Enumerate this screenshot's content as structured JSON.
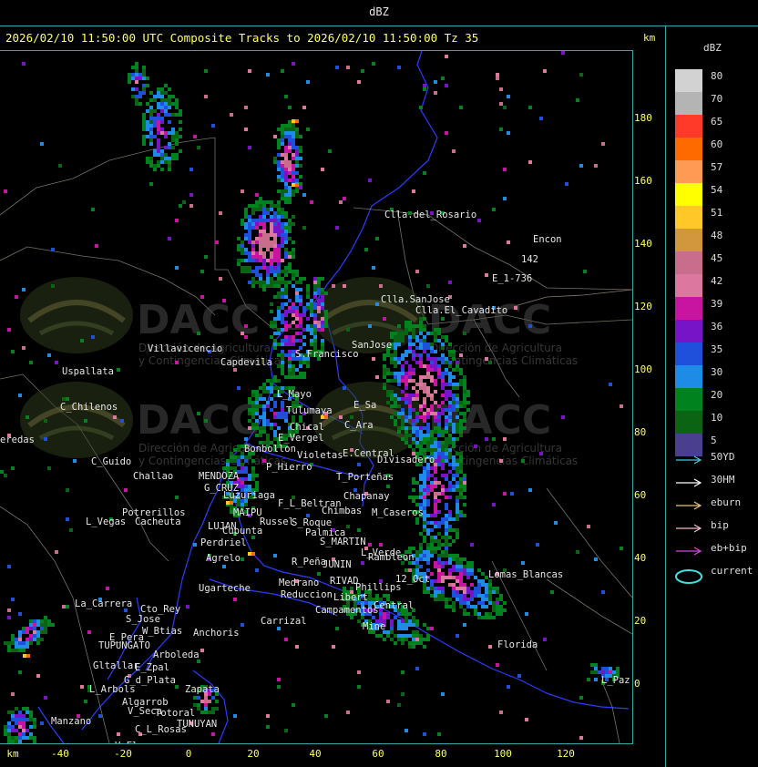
{
  "window": {
    "title": "dBZ"
  },
  "header": {
    "text": "2026/02/10 11:50:00 UTC Composite Tracks to 2026/02/10 11:50:00 Tz 35"
  },
  "axes": {
    "unit_top": "km",
    "unit_bottom": "km",
    "y_ticks": [
      "180",
      "160",
      "140",
      "120",
      "100",
      "80",
      "60",
      "40",
      "20",
      "0"
    ],
    "x_ticks": [
      "-40",
      "-20",
      "0",
      "20",
      "40",
      "60",
      "80",
      "100",
      "120"
    ]
  },
  "legend": {
    "title": "dBZ",
    "levels": [
      {
        "value": "80",
        "color": "#d2d2d2"
      },
      {
        "value": "70",
        "color": "#b4b4b4"
      },
      {
        "value": "65",
        "color": "#ff3a28"
      },
      {
        "value": "60",
        "color": "#ff6a00"
      },
      {
        "value": "57",
        "color": "#ff9a55"
      },
      {
        "value": "54",
        "color": "#ffff00"
      },
      {
        "value": "51",
        "color": "#ffc828"
      },
      {
        "value": "48",
        "color": "#d2963c"
      },
      {
        "value": "45",
        "color": "#c86e8c"
      },
      {
        "value": "42",
        "color": "#dc78a0"
      },
      {
        "value": "39",
        "color": "#c814a0"
      },
      {
        "value": "36",
        "color": "#7814c8"
      },
      {
        "value": "35",
        "color": "#1e50dc"
      },
      {
        "value": "30",
        "color": "#1e8ce6"
      },
      {
        "value": "20",
        "color": "#00821e"
      },
      {
        "value": "10",
        "color": "#0a6414"
      },
      {
        "value": "5",
        "color": "#4a3e8e"
      }
    ]
  },
  "tracks": [
    {
      "label": "50YD",
      "color": "#40c8d8"
    },
    {
      "label": "30HM",
      "color": "#ffffff"
    },
    {
      "label": "eburn",
      "color": "#e8c27a"
    },
    {
      "label": "bip",
      "color": "#f0b8c8"
    },
    {
      "label": "eb+bip",
      "color": "#e040e0"
    },
    {
      "label": "current",
      "color": "#40e0e0"
    }
  ],
  "places": [
    {
      "name": "Clla.del_Rosario"
    },
    {
      "name": "Encon"
    },
    {
      "name": "142"
    },
    {
      "name": "E_1-736"
    },
    {
      "name": "Clla.SanJose"
    },
    {
      "name": "Clla.El_Cavadito"
    },
    {
      "name": "Villavicencio"
    },
    {
      "name": "Uspallata"
    },
    {
      "name": "Capdevila"
    },
    {
      "name": "S.Francisco"
    },
    {
      "name": "SanJose"
    },
    {
      "name": "C_Chilenos"
    },
    {
      "name": "L_Mayo"
    },
    {
      "name": "Tulumaya"
    },
    {
      "name": "E_Sa"
    },
    {
      "name": "C_Ara"
    },
    {
      "name": "eredas"
    },
    {
      "name": "Chical"
    },
    {
      "name": "E_Vergel"
    },
    {
      "name": "Bonbollon"
    },
    {
      "name": "Violetas"
    },
    {
      "name": "E.Central"
    },
    {
      "name": "Divisadero"
    },
    {
      "name": "C_Guido"
    },
    {
      "name": "P_Hierro"
    },
    {
      "name": "Challao"
    },
    {
      "name": "MENDOZA"
    },
    {
      "name": "T_Porteñas"
    },
    {
      "name": "G_CRUZ"
    },
    {
      "name": "Luzuriaga"
    },
    {
      "name": "Chapanay"
    },
    {
      "name": "F_L_Beltran"
    },
    {
      "name": "Chimbas"
    },
    {
      "name": "M_Caseros"
    },
    {
      "name": "Potrerillos"
    },
    {
      "name": "L_Vegas"
    },
    {
      "name": "Cacheuta"
    },
    {
      "name": "MAIPU"
    },
    {
      "name": "Russel"
    },
    {
      "name": "S_Roque"
    },
    {
      "name": "Palmica"
    },
    {
      "name": "LUJAN"
    },
    {
      "name": "Cupunta"
    },
    {
      "name": "S_MARTIN"
    },
    {
      "name": "Perdriel"
    },
    {
      "name": "L_Verde"
    },
    {
      "name": "Agrelo"
    },
    {
      "name": "R_Peña"
    },
    {
      "name": "JUNIN"
    },
    {
      "name": "Rambleon"
    },
    {
      "name": "Ugarteche"
    },
    {
      "name": "Lomas_Blancas"
    },
    {
      "name": "Medrano"
    },
    {
      "name": "RIVAD"
    },
    {
      "name": "Phillips"
    },
    {
      "name": "12_Oct"
    },
    {
      "name": "Reduccion"
    },
    {
      "name": "Libert"
    },
    {
      "name": "La_Carrera"
    },
    {
      "name": "Cto_Rey"
    },
    {
      "name": "Campamentos"
    },
    {
      "name": "Central"
    },
    {
      "name": "S_Jose"
    },
    {
      "name": "Carrizal"
    },
    {
      "name": "E_Pera"
    },
    {
      "name": "W_Btias"
    },
    {
      "name": "Anchoris"
    },
    {
      "name": "Mine"
    },
    {
      "name": "Florida"
    },
    {
      "name": "TUPUNGATO"
    },
    {
      "name": "Arboleda"
    },
    {
      "name": "Gltallar"
    },
    {
      "name": "E_Zpal"
    },
    {
      "name": "G_d_Plata"
    },
    {
      "name": "L_Arbols"
    },
    {
      "name": "Zapata"
    },
    {
      "name": "Algarrob"
    },
    {
      "name": "V_Seca"
    },
    {
      "name": "Totoral"
    },
    {
      "name": "TUNUYAN"
    },
    {
      "name": "Manzano"
    },
    {
      "name": "C_L_Rosas"
    },
    {
      "name": "V_Flores"
    },
    {
      "name": "L_Paz"
    }
  ],
  "watermark": {
    "brand": "DACC",
    "line1": "Dirección de Agricultura",
    "line2": "y Contingencias Climáticas"
  }
}
